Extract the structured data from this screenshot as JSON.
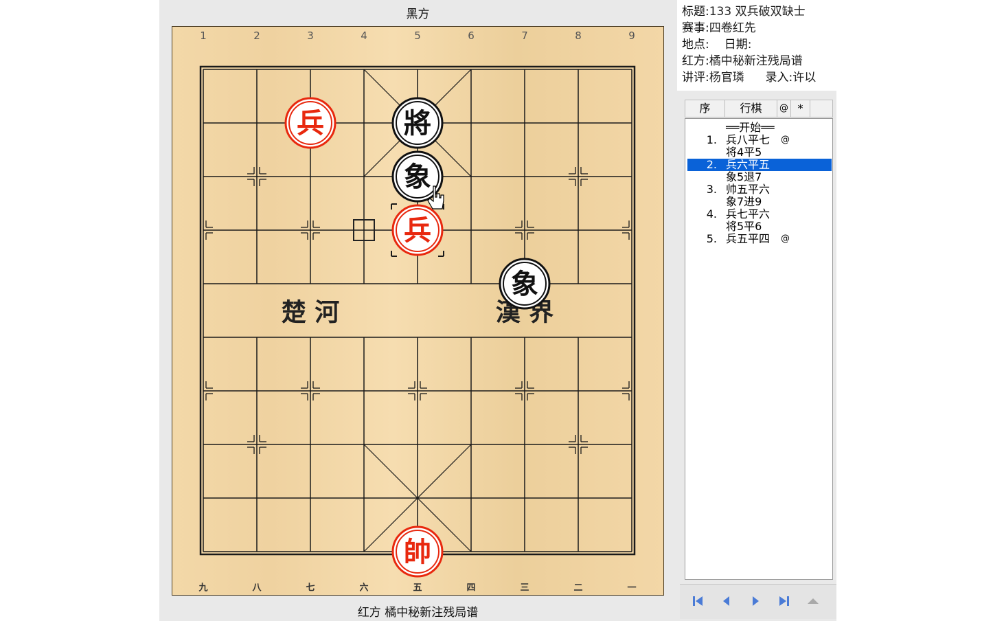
{
  "board": {
    "top_label": "黑方",
    "bottom_label": "红方 橘中秘新注残局谱",
    "top_numbers": [
      "1",
      "2",
      "3",
      "4",
      "5",
      "6",
      "7",
      "8",
      "9"
    ],
    "bottom_numbers": [
      "九",
      "八",
      "七",
      "六",
      "五",
      "四",
      "三",
      "二",
      "一"
    ],
    "river_left": "楚 河",
    "river_right": "漢 界",
    "pieces": [
      {
        "side": "red",
        "char": "兵",
        "col": 2,
        "row": 1
      },
      {
        "side": "black",
        "char": "將",
        "col": 4,
        "row": 1
      },
      {
        "side": "black",
        "char": "象",
        "col": 4,
        "row": 2
      },
      {
        "side": "red",
        "char": "兵",
        "col": 4,
        "row": 3
      },
      {
        "side": "black",
        "char": "象",
        "col": 6,
        "row": 4
      },
      {
        "side": "red",
        "char": "帥",
        "col": 4,
        "row": 9
      }
    ],
    "selected": {
      "col": 4,
      "row": 3
    },
    "from_marker": {
      "col": 3,
      "row": 3
    },
    "colors": {
      "red": "#e8280e",
      "black": "#111111",
      "line": "#1a1a1a"
    }
  },
  "info": {
    "title_label": "标题:",
    "title_value": "133 双兵破双缺士",
    "event_label": "赛事:",
    "event_value": "四卷红先",
    "place_label": "地点:",
    "date_label": "日期:",
    "red_label": "红方:",
    "red_value": "橘中秘新注残局谱",
    "commentary_label": "讲评:",
    "commentary_value": "杨官璘",
    "entry_label": "录入:",
    "entry_value": "许以"
  },
  "moves_header": {
    "seq": "序",
    "move": "行棋",
    "at": "@",
    "star": "*"
  },
  "moves": [
    {
      "num": "",
      "text": "══开始══",
      "mark": ""
    },
    {
      "num": "1.",
      "text": "兵八平七",
      "mark": "@"
    },
    {
      "num": "",
      "text": "将4平5",
      "mark": ""
    },
    {
      "num": "2.",
      "text": "兵六平五",
      "mark": "",
      "selected": true
    },
    {
      "num": "",
      "text": "象5退7",
      "mark": ""
    },
    {
      "num": "3.",
      "text": "帅五平六",
      "mark": ""
    },
    {
      "num": "",
      "text": "象7进9",
      "mark": ""
    },
    {
      "num": "4.",
      "text": "兵七平六",
      "mark": ""
    },
    {
      "num": "",
      "text": "将5平6",
      "mark": ""
    },
    {
      "num": "5.",
      "text": "兵五平四",
      "mark": "@"
    }
  ],
  "nav": [
    "first-icon",
    "prev-icon",
    "next-icon",
    "last-icon",
    "up-icon"
  ]
}
